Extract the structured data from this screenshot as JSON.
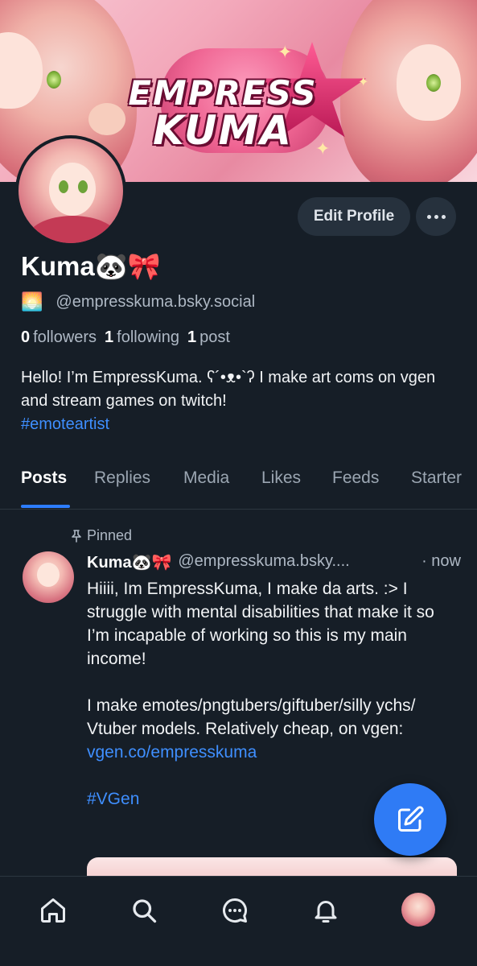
{
  "banner": {
    "logo_line1": "EMPRESS",
    "logo_line2": "KUMA"
  },
  "profile": {
    "edit_label": "Edit Profile",
    "display_name": "Kuma🐼🎀",
    "status_emoji": "🌅",
    "handle": "@empresskuma.bsky.social",
    "followers_count": "0",
    "followers_label": "followers",
    "following_count": "1",
    "following_label": "following",
    "posts_count": "1",
    "posts_label": "post",
    "bio_text": "Hello! I’m EmpressKuma. ʕ´•ᴥ•`ʔ I make art coms on vgen and stream games on twitch!",
    "bio_hashtag": "#emoteartist"
  },
  "tabs": [
    {
      "label": "Posts",
      "active": true
    },
    {
      "label": "Replies",
      "active": false
    },
    {
      "label": "Media",
      "active": false
    },
    {
      "label": "Likes",
      "active": false
    },
    {
      "label": "Feeds",
      "active": false
    },
    {
      "label": "Starter",
      "active": false
    }
  ],
  "post": {
    "pinned_label": "Pinned",
    "author_name": "Kuma🐼🎀",
    "author_handle": "@empresskuma.bsky....",
    "time": "· now",
    "para1": "Hiiii, Im EmpressKuma, I make da arts. :> I struggle with mental disabilities that make it so I’m incapable of working so this is my main income!",
    "para2": "I make emotes/pngtubers/giftuber/silly ychs/ Vtuber models. Relatively cheap, on vgen:",
    "link": "vgen.co/empresskuma",
    "hashtag": "#VGen"
  },
  "nav": {
    "items": [
      "home-icon",
      "search-icon",
      "chat-icon",
      "bell-icon",
      "profile-avatar"
    ]
  },
  "colors": {
    "background": "#161e27",
    "accent": "#2f7bf5",
    "link": "#3f8fff"
  }
}
